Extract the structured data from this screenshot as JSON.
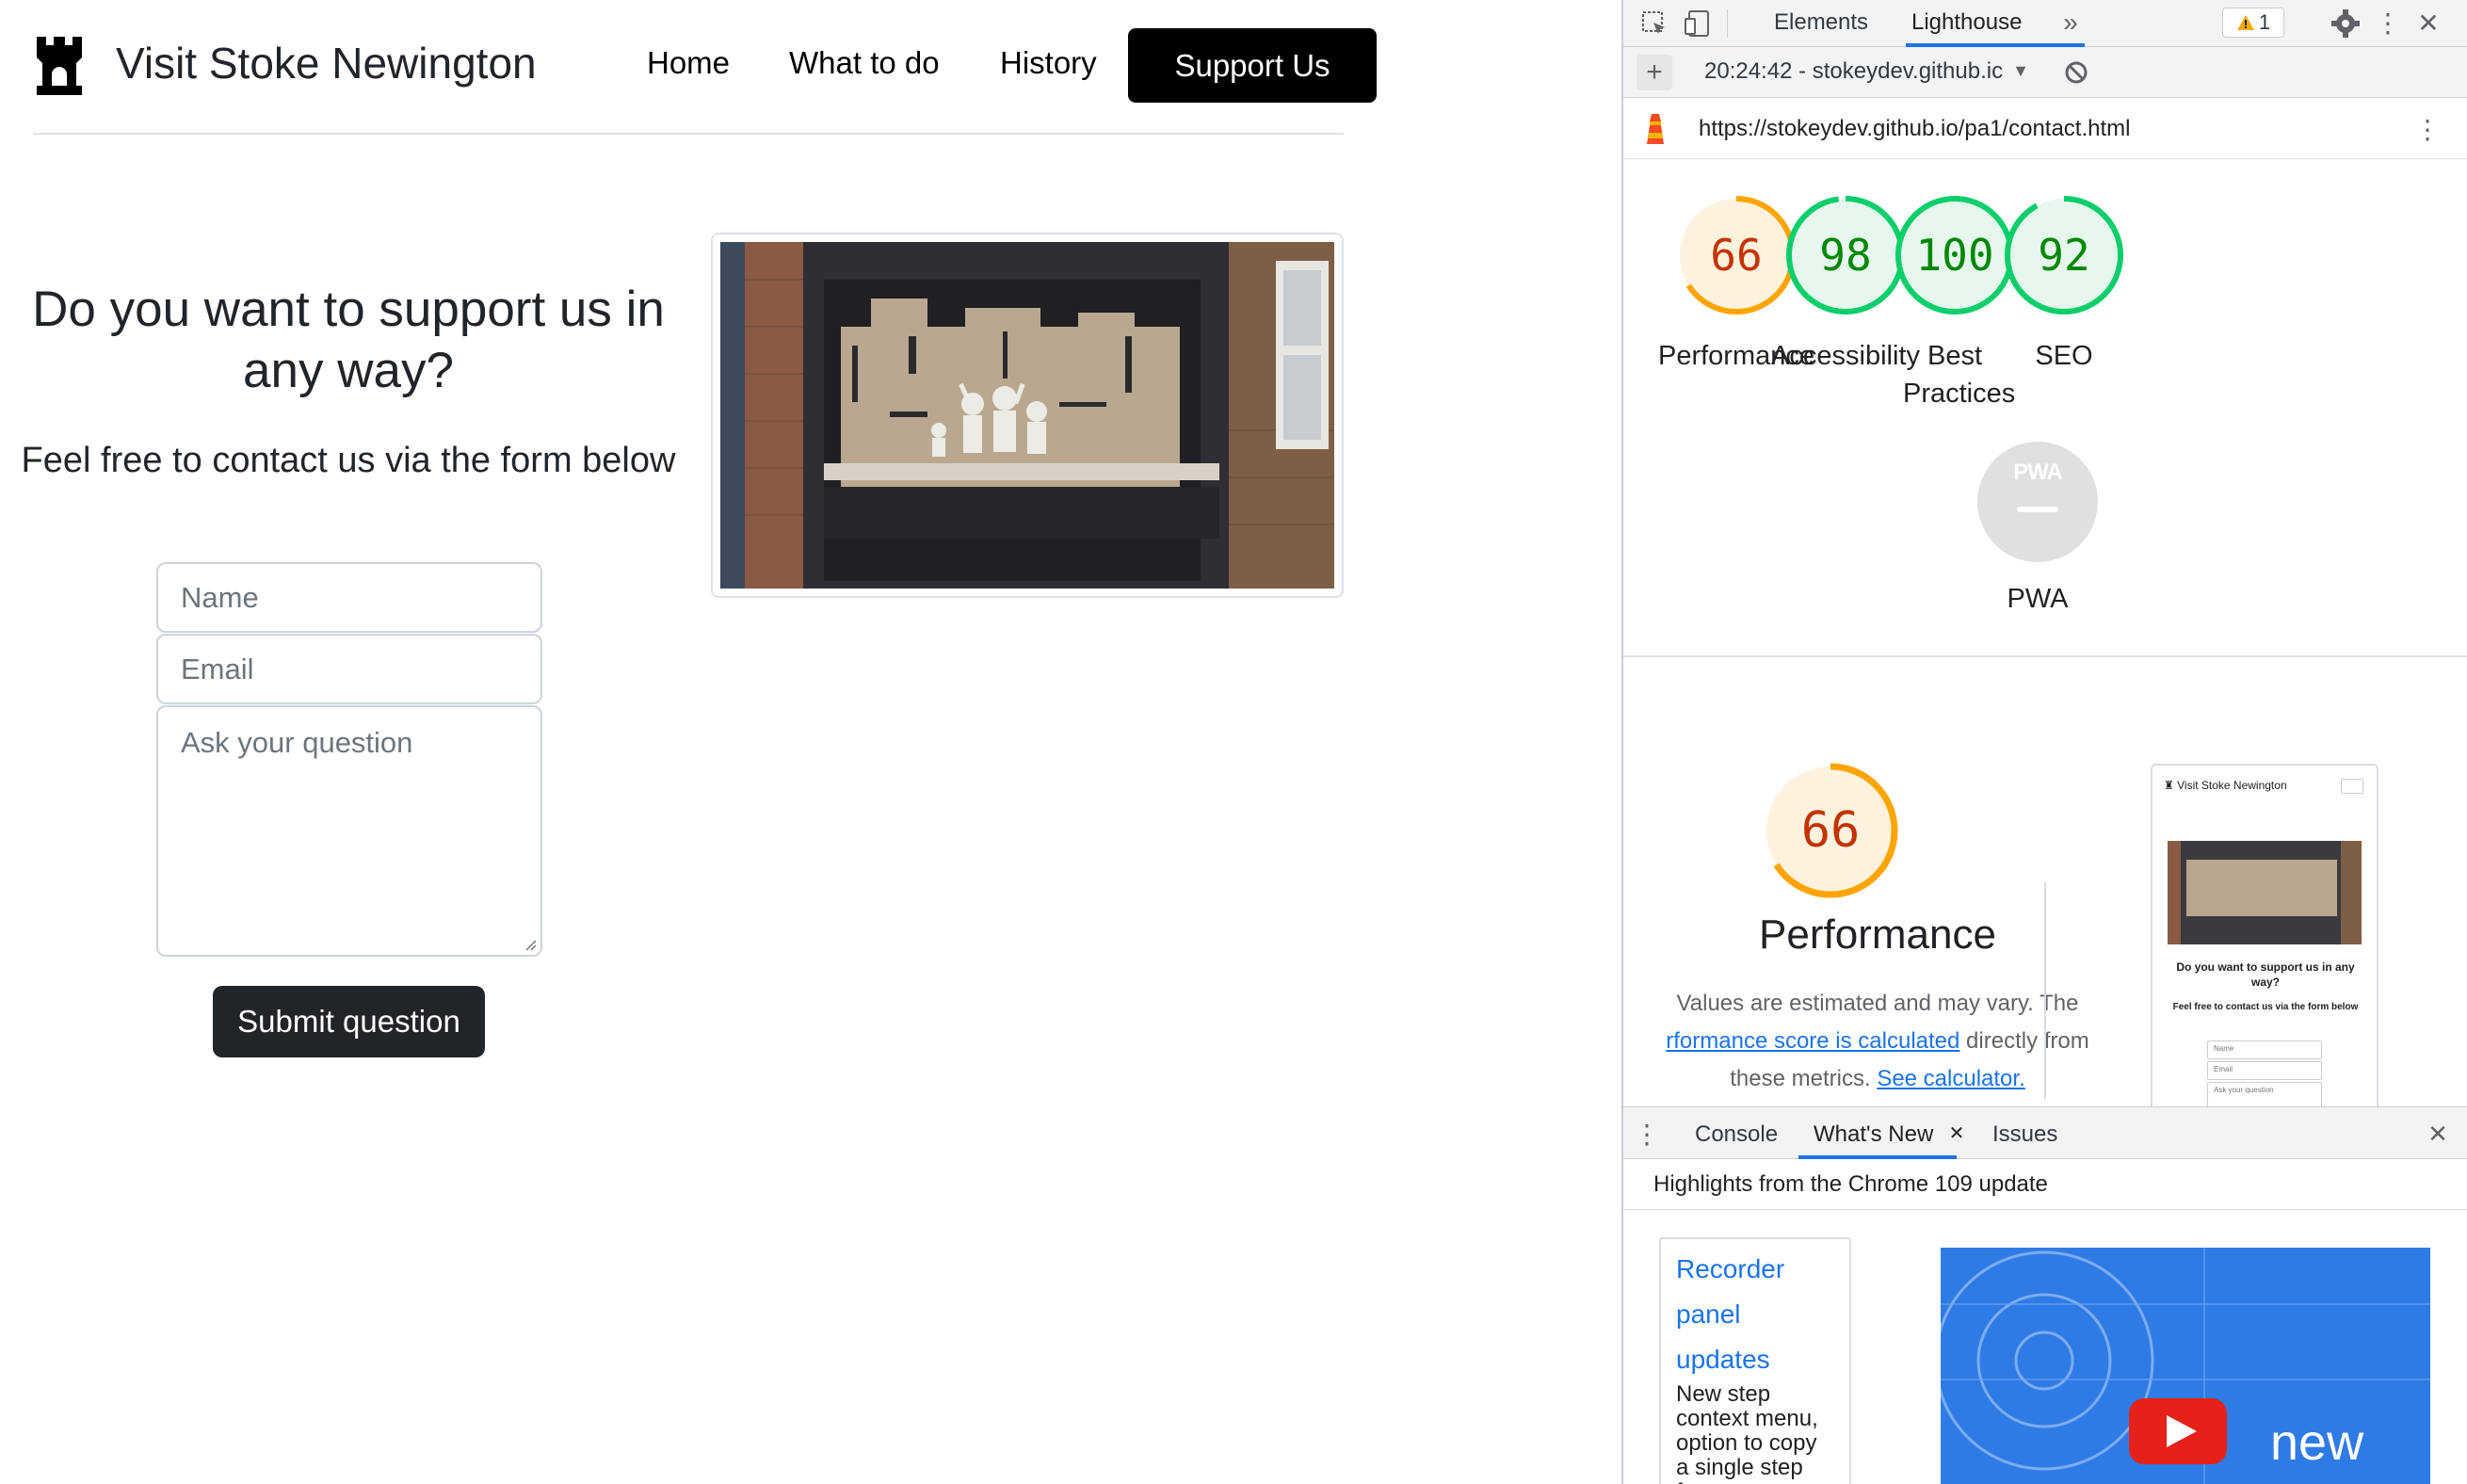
{
  "site": {
    "brand": "Visit Stoke Newington",
    "nav": [
      "Home",
      "What to do",
      "History",
      "Support Us"
    ],
    "heading": "Do you want to support us in any way?",
    "subheading": "Feel free to contact us via the form below",
    "form": {
      "name_placeholder": "Name",
      "email_placeholder": "Email",
      "question_placeholder": "Ask your question",
      "submit_label": "Submit question"
    }
  },
  "devtools": {
    "tabs": [
      "Elements",
      "Lighthouse"
    ],
    "warning_count": "1",
    "report_time": "20:24:42 - stokeydev.github.ic",
    "url": "https://stokeydev.github.io/pa1/contact.html",
    "scores": [
      {
        "value": "66",
        "label": "Performance",
        "color": "#c33300",
        "ring": "#ffa400",
        "fraction": 0.66
      },
      {
        "value": "98",
        "label": "Accessibility",
        "color": "#008800",
        "ring": "#0cce6b",
        "fraction": 0.98
      },
      {
        "value": "100",
        "label": "Best Practices",
        "color": "#008800",
        "ring": "#0cce6b",
        "fraction": 1.0
      },
      {
        "value": "92",
        "label": "SEO",
        "color": "#008800",
        "ring": "#0cce6b",
        "fraction": 0.92
      }
    ],
    "pwa": {
      "badge": "PWA",
      "label": "PWA"
    },
    "performance": {
      "score": "66",
      "title": "Performance",
      "desc_1": "Values are estimated and may vary. The",
      "desc_link": "rformance score is calculated",
      "desc_2": " directly from",
      "desc_3": "these metrics.",
      "calc_link": "See calculator."
    },
    "thumbnail": {
      "brand": "Visit Stoke Newington",
      "heading": "Do you want to support us in any way?",
      "sub": "Feel free to contact us via the form below",
      "fields": [
        "Name",
        "Email",
        "Ask your question"
      ]
    },
    "drawer": {
      "tabs": [
        "Console",
        "What's New",
        "Issues"
      ],
      "highlights": "Highlights from the Chrome 109 update",
      "card_title_1": "Recorder",
      "card_title_2": "panel",
      "card_title_3": "updates",
      "card_desc": "New step context menu, option to copy a single step from a",
      "video_text": "new"
    }
  }
}
